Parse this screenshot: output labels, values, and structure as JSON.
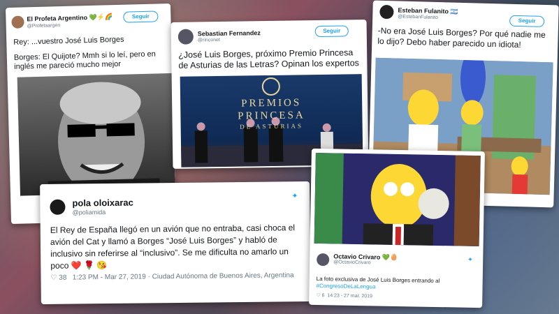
{
  "tweets": [
    {
      "name": "El Profeta Argentino 💚⚡🌈",
      "handle": "@Profetaargen",
      "follow_label": "Seguir",
      "line1": "Rey: ...vuestro José Luis Borges",
      "line2": "Borges: El Quijote? Mmh si lo leí, pero en inglés me pareció mucho mejor",
      "photo_icon": "borges-meme-photo"
    },
    {
      "name": "Sebastian Fernandez",
      "handle": "@rinconet",
      "follow_label": "Seguir",
      "text": "¿José Luis Borges, próximo Premio Princesa de Asturias de las Letras? Opinan los expertos",
      "photo_line1": "PREMIOS",
      "photo_line2": "PRINCESA",
      "photo_line3": "DE ASTURIAS"
    },
    {
      "name": "Esteban Fulanito 🇦🇷",
      "handle": "@EstebanFulanito",
      "follow_label": "Seguir",
      "text": "-No era José Luis Borges? Por qué nadie me lo dijo? Debo haber parecido un idiota!"
    },
    {
      "name": "pola oloixarac",
      "handle": "@poliamida",
      "text": "El Rey de España llegó en un avión que no entraba, casi choca el avión del Cat y llamó a Borges “José Luis Borges” y habló de inclusivo sin referirse al “inclusivo”. Se me dificulta no amarlo un poco",
      "emojis": "❤️ 🌹 😘",
      "likes": "38",
      "timestamp": "1:23 PM - Mar 27, 2019",
      "location": "Ciudad Autónoma de Buenos Aires, Argentina"
    },
    {
      "name": "Octavio Crivaro 💚🥚",
      "handle": "@OctavioCrivaro",
      "text": "La foto exclusiva de José Luis Borges entrando al",
      "hashtag": "#CongresoDeLaLengua",
      "likes": "6",
      "timestamp": "14:23 - 27 mar. 2019"
    }
  ],
  "colors": {
    "twitter_blue": "#1da1f2",
    "heart": "#e0245e"
  }
}
